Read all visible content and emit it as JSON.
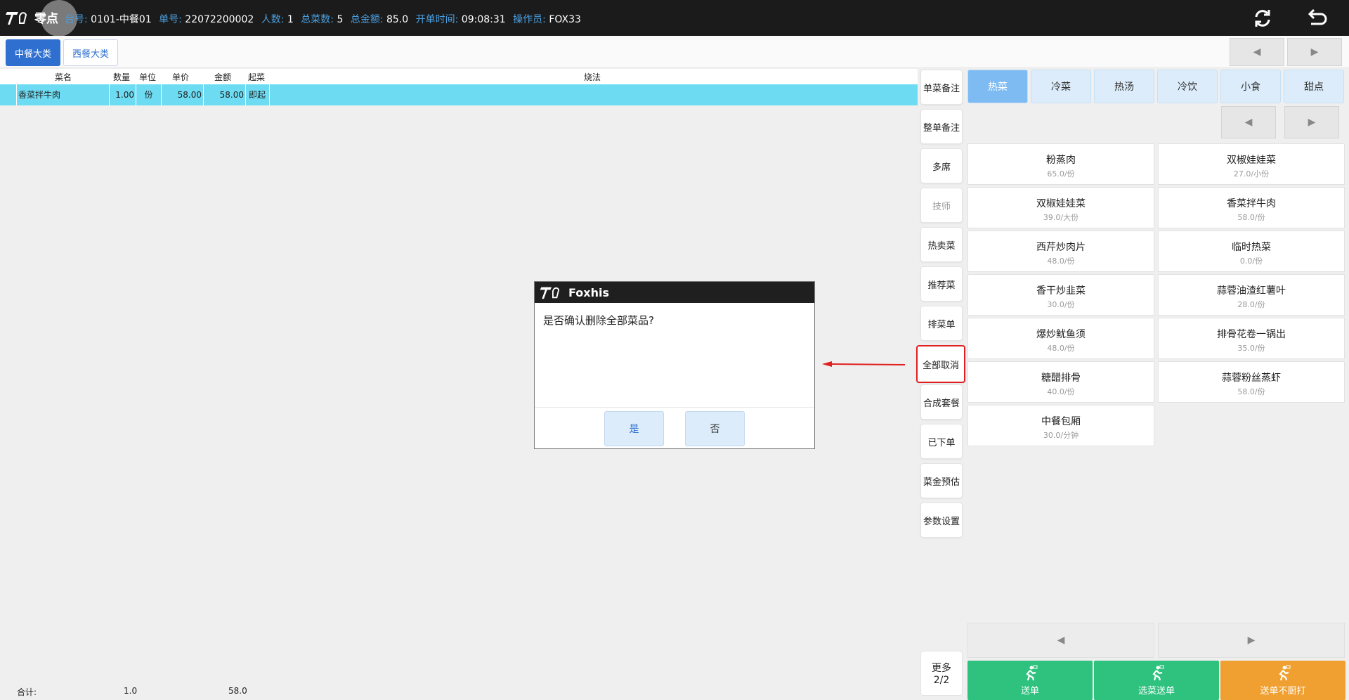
{
  "app": {
    "logo_text": "零点",
    "dialog_brand": "Foxhis"
  },
  "info": [
    {
      "k": "台号:",
      "v": "0101-中餐01"
    },
    {
      "k": "单号:",
      "v": "22072200002"
    },
    {
      "k": "人数:",
      "v": "1"
    },
    {
      "k": "总菜数:",
      "v": "5"
    },
    {
      "k": "总金额:",
      "v": "85.0"
    },
    {
      "k": "开单时间:",
      "v": "09:08:31"
    },
    {
      "k": "操作员:",
      "v": "FOX33"
    }
  ],
  "categories": [
    "中餐大类",
    "西餐大类"
  ],
  "nav": {
    "prev": "◀",
    "next": "▶"
  },
  "order_headers": [
    "菜名",
    "数量",
    "单位",
    "单价",
    "金额",
    "起菜",
    "烧法"
  ],
  "order_row": {
    "name": "香菜拌牛肉",
    "qty": "1.00",
    "unit": "份",
    "price": "58.00",
    "amount": "58.00",
    "start": "即起",
    "method": ""
  },
  "footer": {
    "label": "合计:",
    "qty": "1.0",
    "amount": "58.0"
  },
  "side_buttons": [
    "单菜备注",
    "整单备注",
    "多席",
    "技师",
    "热卖菜",
    "推荐菜",
    "排菜单",
    "全部取消",
    "合成套餐",
    "已下单",
    "菜金预估",
    "参数设置"
  ],
  "more": {
    "label": "更多",
    "page": "2/2"
  },
  "tabs": [
    "热菜",
    "冷菜",
    "热汤",
    "冷饮",
    "小食",
    "甜点"
  ],
  "dishes": [
    {
      "name": "粉蒸肉",
      "price": "65.0/份"
    },
    {
      "name": "双椒娃娃菜",
      "price": "27.0/小份"
    },
    {
      "name": "双椒娃娃菜",
      "price": "39.0/大份"
    },
    {
      "name": "香菜拌牛肉",
      "price": "58.0/份"
    },
    {
      "name": "西芹炒肉片",
      "price": "48.0/份"
    },
    {
      "name": "临时热菜",
      "price": "0.0/份"
    },
    {
      "name": "香干炒韭菜",
      "price": "30.0/份"
    },
    {
      "name": "蒜蓉油渣红薯叶",
      "price": "28.0/份"
    },
    {
      "name": "爆炒鱿鱼须",
      "price": "48.0/份"
    },
    {
      "name": "排骨花卷一锅出",
      "price": "35.0/份"
    },
    {
      "name": "糖醋排骨",
      "price": "40.0/份"
    },
    {
      "name": "蒜蓉粉丝蒸虾",
      "price": "58.0/份"
    },
    {
      "name": "中餐包厢",
      "price": "30.0/分钟"
    }
  ],
  "actions": [
    {
      "label": "送单",
      "color": "#2ec27e"
    },
    {
      "label": "选菜送单",
      "color": "#2ec27e"
    },
    {
      "label": "送单不厨打",
      "color": "#f0a030"
    }
  ],
  "dialog": {
    "message": "是否确认删除全部菜品?",
    "yes": "是",
    "no": "否"
  },
  "colors": {
    "row_highlight": "#6ddcf3",
    "accent_blue": "#2e6fd0",
    "alert_red": "#e02020"
  }
}
